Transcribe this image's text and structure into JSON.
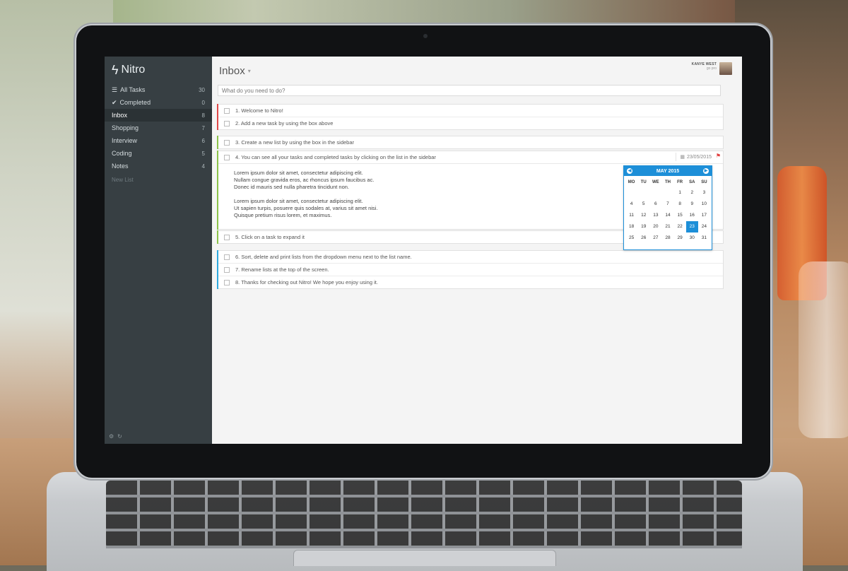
{
  "app": {
    "name": "Nitro",
    "logo_icon": "bolt-icon"
  },
  "sidebar": {
    "items": [
      {
        "label": "All Tasks",
        "count": "30",
        "icon": "list-icon"
      },
      {
        "label": "Completed",
        "count": "0",
        "icon": "check-icon"
      },
      {
        "label": "Inbox",
        "count": "8",
        "icon": ""
      },
      {
        "label": "Shopping",
        "count": "7",
        "icon": ""
      },
      {
        "label": "Interview",
        "count": "6",
        "icon": ""
      },
      {
        "label": "Coding",
        "count": "5",
        "icon": ""
      },
      {
        "label": "Notes",
        "count": "4",
        "icon": ""
      }
    ],
    "new_list": "New List",
    "footer_icons": [
      "gear-icon",
      "sync-icon"
    ]
  },
  "header": {
    "title": "Inbox",
    "user_name": "KANYE WEST",
    "user_sub": "go pro"
  },
  "add_task": {
    "placeholder": "What do you need to do?"
  },
  "tasks": {
    "red": [
      "1. Welcome to Nitro!",
      "2. Add a new task by using the box above"
    ],
    "green_3": "3. Create a new list by using the box in the sidebar",
    "green_4": "4. You can see all your tasks and completed tasks by clicking on the list in the sidebar",
    "green_5": "5. Click on a task to expand it",
    "blue": [
      "6. Sort, delete and print lists from the dropdown menu next to the list name.",
      "7. Rename lists at the top of the screen.",
      "8. Thanks for checking out Nitro! We hope you enjoy using it."
    ]
  },
  "expanded_task": {
    "date": "23/05/2015",
    "notes": [
      "Lorem ipsum dolor sit amet, consectetur adipiscing elit.",
      "Nullam congue gravida eros, ac rhoncus ipsum faucibus ac.",
      "Donec id mauris sed nulla pharetra tincidunt non.",
      "Lorem ipsum dolor sit amet, consectetur adipiscing elit.",
      "Ut sapien turpis, posuere quis sodales at, varius sit amet nisi.",
      "Quisque pretium risus lorem, et maximus."
    ]
  },
  "datepicker": {
    "month": "MAY 2015",
    "weekdays": [
      "MO",
      "TU",
      "WE",
      "TH",
      "FR",
      "SA",
      "SU"
    ],
    "weeks": [
      [
        "",
        "",
        "",
        "",
        "1",
        "2",
        "3"
      ],
      [
        "4",
        "5",
        "6",
        "7",
        "8",
        "9",
        "10"
      ],
      [
        "11",
        "12",
        "13",
        "14",
        "15",
        "16",
        "17"
      ],
      [
        "18",
        "19",
        "20",
        "21",
        "22",
        "23",
        "24"
      ],
      [
        "25",
        "26",
        "27",
        "28",
        "29",
        "30",
        "31"
      ]
    ],
    "selected": "23"
  },
  "colors": {
    "red": "#e04848",
    "green": "#8bc34a",
    "blue": "#2eaadf",
    "accent": "#1d8fd8"
  }
}
